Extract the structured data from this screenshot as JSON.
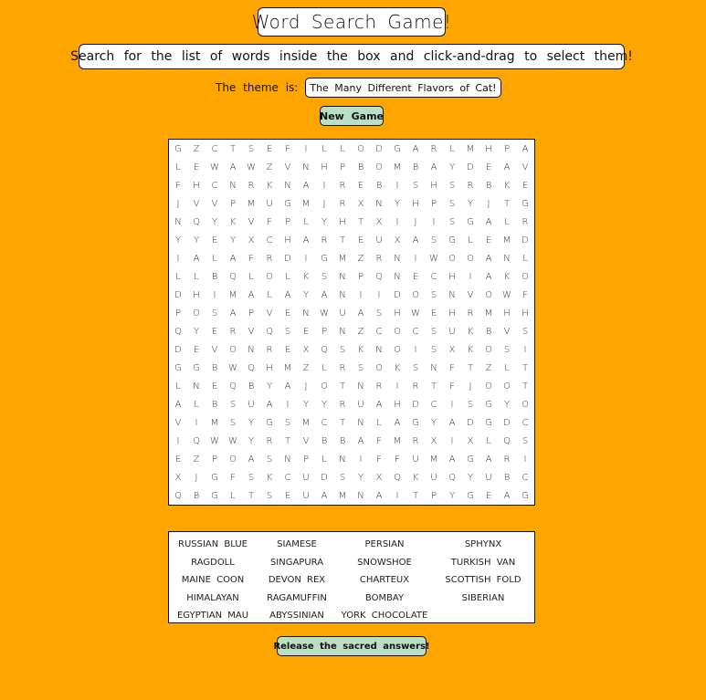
{
  "header": {
    "title": "Word Search Game!",
    "instructions": "Search for the list of words inside the box and click-and-drag to select them!"
  },
  "theme": {
    "label": "The theme is:",
    "value": "The Many Different Flavors of Cat!"
  },
  "buttons": {
    "new_game": "New Game",
    "answers": "Release the sacred answers!"
  },
  "colors": {
    "background": "#FFA500",
    "button": "#B9DFC4"
  },
  "grid": [
    "GZCTSEFILLODGARLMHPA",
    "LEWAWZVNHPBOMBAYDEAV",
    "FHCNRKNAIREBISHSRBKE",
    "JVVPMUGMJRXNYHPSYJTG",
    "NQYKVFPLYHTXIJISGALR",
    "YYEYXCHARTEUXASGLEMD",
    "IALAFRDIGMZRNIWOOANL",
    "LLBQLOLKSNPQNECHIAKO",
    "DHIMALAYANIIDOSNVOWF",
    "POSAPVENWUASHWEHRMHH",
    "QYERVQSEPNZCOCSUKBVS",
    "DEVONREXQSKNOISXKOSI",
    "GGBWQHMZLRSOKSNFTZLT",
    "LNEQBYAJOTNRIRTFJOOT",
    "ALBSUAIYYRUAHDCISGYO",
    "VIMSYGSMCTNLAGYADGDC",
    "IQWWYRTVBBAFMRXIXLQS",
    "EZPOASNPLNIFFUMAGARI",
    "XJGFSKCUDSYXQKUQYUBC",
    "QBGLTSEUAMNAITPYGEAG"
  ],
  "words": [
    "RUSSIAN BLUE",
    "SIAMESE",
    "PERSIAN",
    "SPHYNX",
    "RAGDOLL",
    "SINGAPURA",
    "SNOWSHOE",
    "TURKISH VAN",
    "MAINE COON",
    "DEVON REX",
    "CHARTEUX",
    "SCOTTISH FOLD",
    "HIMALAYAN",
    "RAGAMUFFIN",
    "BOMBAY",
    "SIBERIAN",
    "EGYPTIAN MAU",
    "ABYSSINIAN",
    "YORK CHOCOLATE"
  ]
}
